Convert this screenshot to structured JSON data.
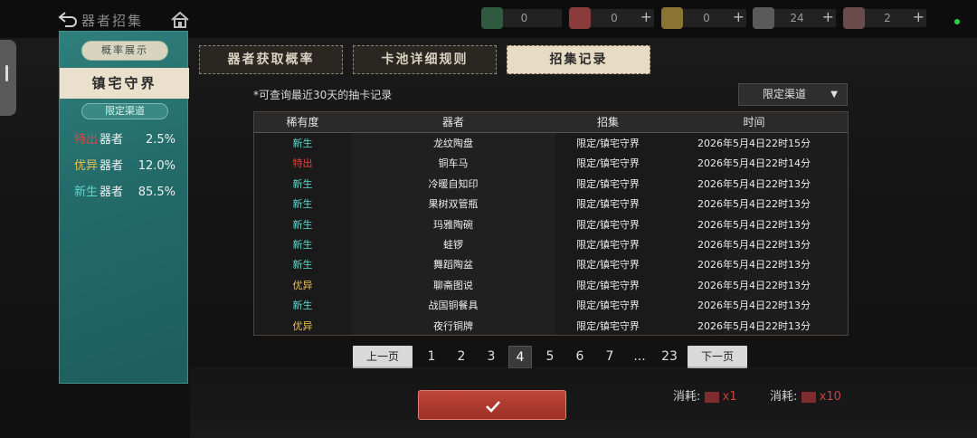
{
  "header": {
    "title": "器者招集"
  },
  "resources": [
    {
      "icon": "jade-coin-icon",
      "value": "0",
      "has_plus": false
    },
    {
      "icon": "red-envelope-icon",
      "value": "0",
      "has_plus": true
    },
    {
      "icon": "gold-coin-icon",
      "value": "0",
      "has_plus": true
    },
    {
      "icon": "ticket-icon",
      "value": "24",
      "has_plus": true
    },
    {
      "icon": "scroll-icon",
      "value": "2",
      "has_plus": true
    }
  ],
  "left_panel": {
    "title": "概率展示",
    "pool_name": "镇宅守界",
    "channel": "限定渠道",
    "rates": [
      {
        "rarity": "特出",
        "label": "器者",
        "percent": "2.5%",
        "color": "#e0433b"
      },
      {
        "rarity": "优异",
        "label": "器者",
        "percent": "12.0%",
        "color": "#e8c34a"
      },
      {
        "rarity": "新生",
        "label": "器者",
        "percent": "85.5%",
        "color": "#5fd7cf"
      }
    ]
  },
  "tabs": [
    {
      "label": "器者获取概率",
      "active": false
    },
    {
      "label": "卡池详细规则",
      "active": false
    },
    {
      "label": "招集记录",
      "active": true
    }
  ],
  "records": {
    "note": "*可查询最近30天的抽卡记录",
    "filter": "限定渠道",
    "headers": [
      "稀有度",
      "器者",
      "招集",
      "时间"
    ],
    "rows": [
      {
        "rarity": "新生",
        "item": "龙纹陶盘",
        "source": "限定/镇宅守界",
        "time": "2026年5月4日22时15分"
      },
      {
        "rarity": "特出",
        "item": "铜车马",
        "source": "限定/镇宅守界",
        "time": "2026年5月4日22时14分"
      },
      {
        "rarity": "新生",
        "item": "冷暖自知印",
        "source": "限定/镇宅守界",
        "time": "2026年5月4日22时13分"
      },
      {
        "rarity": "新生",
        "item": "果树双管瓶",
        "source": "限定/镇宅守界",
        "time": "2026年5月4日22时13分"
      },
      {
        "rarity": "新生",
        "item": "玛雅陶碗",
        "source": "限定/镇宅守界",
        "time": "2026年5月4日22时13分"
      },
      {
        "rarity": "新生",
        "item": "蛙锣",
        "source": "限定/镇宅守界",
        "time": "2026年5月4日22时13分"
      },
      {
        "rarity": "新生",
        "item": "舞蹈陶盆",
        "source": "限定/镇宅守界",
        "time": "2026年5月4日22时13分"
      },
      {
        "rarity": "优异",
        "item": "聊斋图说",
        "source": "限定/镇宅守界",
        "time": "2026年5月4日22时13分"
      },
      {
        "rarity": "新生",
        "item": "战国铜餐具",
        "source": "限定/镇宅守界",
        "time": "2026年5月4日22时13分"
      },
      {
        "rarity": "优异",
        "item": "夜行铜牌",
        "source": "限定/镇宅守界",
        "time": "2026年5月4日22时13分"
      }
    ],
    "rarity_colors": {
      "新生": "#5fd7cf",
      "特出": "#e0433b",
      "优异": "#e8c34a"
    }
  },
  "pager": {
    "prev": "上一页",
    "next": "下一页",
    "pages": [
      "1",
      "2",
      "3",
      "4",
      "5",
      "6",
      "7",
      "...",
      "23"
    ],
    "current": "4"
  },
  "bottom": {
    "consume_label_1": "消耗:",
    "consume_count_1": "x1",
    "consume_label_2": "消耗:",
    "consume_count_2": "x10"
  }
}
